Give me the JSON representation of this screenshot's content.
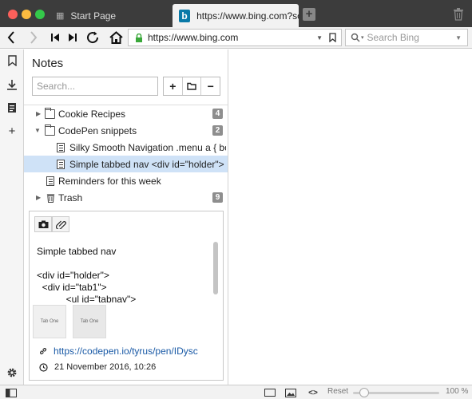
{
  "tabs": [
    {
      "label": "Start Page",
      "icon": "grid-icon",
      "active": false
    },
    {
      "label": "https://www.bing.com?scop",
      "icon": "bing-icon",
      "active": true
    }
  ],
  "address": {
    "url": "https://www.bing.com",
    "search_placeholder": "Search Bing"
  },
  "notes": {
    "title": "Notes",
    "search_placeholder": "Search...",
    "actions": [
      "+",
      "folder",
      "−"
    ],
    "items": [
      {
        "label": "Cookie Recipes",
        "type": "folder",
        "badge": "4",
        "expanded": false
      },
      {
        "label": "CodePen snippets",
        "type": "folder",
        "badge": "2",
        "expanded": true
      },
      {
        "label": "Silky Smooth Navigation .menu a { bor...",
        "type": "note"
      },
      {
        "label": "Simple tabbed nav <div id=\"holder\"> ...",
        "type": "note",
        "selected": true
      },
      {
        "label": "Reminders for this week",
        "type": "note"
      },
      {
        "label": "Trash",
        "type": "trash",
        "badge": "9",
        "expanded": false
      }
    ],
    "editor": {
      "body": "Simple tabbed nav\n\n<div id=\"holder\">\n  <div id=\"tab1\">\n           <ul id=\"tabnav\">",
      "thumb1": "Tab One",
      "thumb2": "Tab One",
      "link": "https://codepen.io/tyrus/pen/IDysc",
      "date": "21 November 2016, 10:26"
    }
  },
  "statusbar": {
    "reset": "Reset",
    "zoom": "100 %",
    "zoom_fraction": 0.1
  },
  "colors": {
    "tabbar": "#3c3c3c",
    "selected_row": "#cfe2f7",
    "link": "#1a5aa6",
    "lock": "#3aa83a"
  }
}
